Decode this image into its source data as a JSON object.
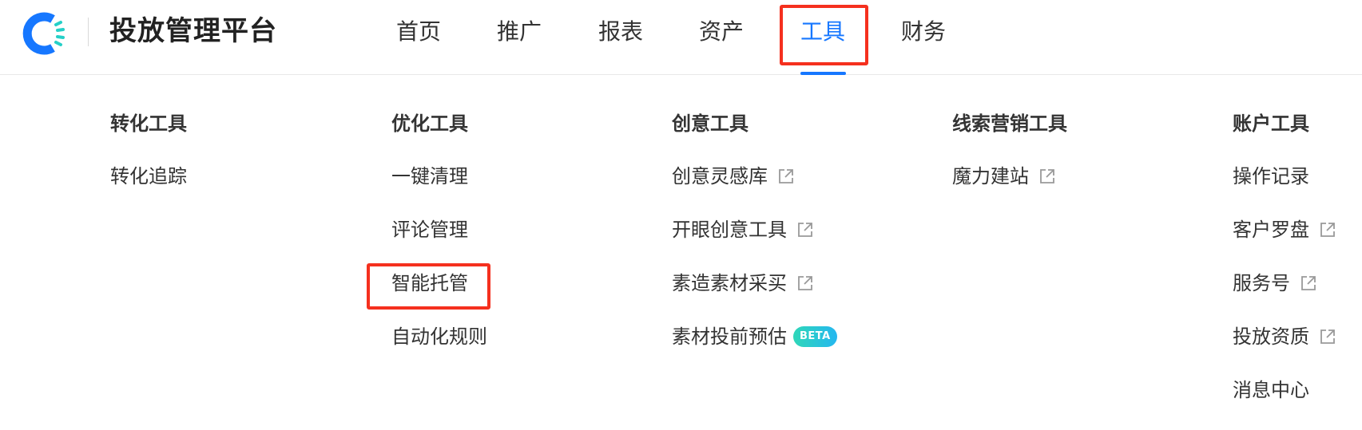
{
  "app": {
    "brand": "投放管理平台",
    "logo_icon": "ring-logo-icon",
    "accent_color": "#1677ff",
    "highlight_color": "#f5301e"
  },
  "nav": {
    "items": [
      {
        "label": "首页"
      },
      {
        "label": "推广"
      },
      {
        "label": "报表"
      },
      {
        "label": "资产"
      },
      {
        "label": "工具",
        "active": true
      },
      {
        "label": "财务"
      }
    ]
  },
  "menu": {
    "columns": [
      {
        "title": "转化工具",
        "items": [
          {
            "label": "转化追踪"
          }
        ]
      },
      {
        "title": "优化工具",
        "items": [
          {
            "label": "一键清理"
          },
          {
            "label": "评论管理"
          },
          {
            "label": "智能托管",
            "highlighted": true
          },
          {
            "label": "自动化规则"
          }
        ]
      },
      {
        "title": "创意工具",
        "items": [
          {
            "label": "创意灵感库",
            "icon": "external-link-icon"
          },
          {
            "label": "开眼创意工具",
            "icon": "external-link-icon"
          },
          {
            "label": "素造素材采买",
            "icon": "external-link-icon"
          },
          {
            "label": "素材投前预估",
            "badge": "BETA"
          }
        ]
      },
      {
        "title": "线索营销工具",
        "items": [
          {
            "label": "魔力建站",
            "icon": "external-link-icon"
          }
        ]
      },
      {
        "title": "账户工具",
        "items": [
          {
            "label": "操作记录"
          },
          {
            "label": "客户罗盘",
            "icon": "external-link-icon"
          },
          {
            "label": "服务号",
            "icon": "external-link-icon"
          },
          {
            "label": "投放资质",
            "icon": "external-link-icon"
          },
          {
            "label": "消息中心"
          }
        ]
      }
    ]
  }
}
